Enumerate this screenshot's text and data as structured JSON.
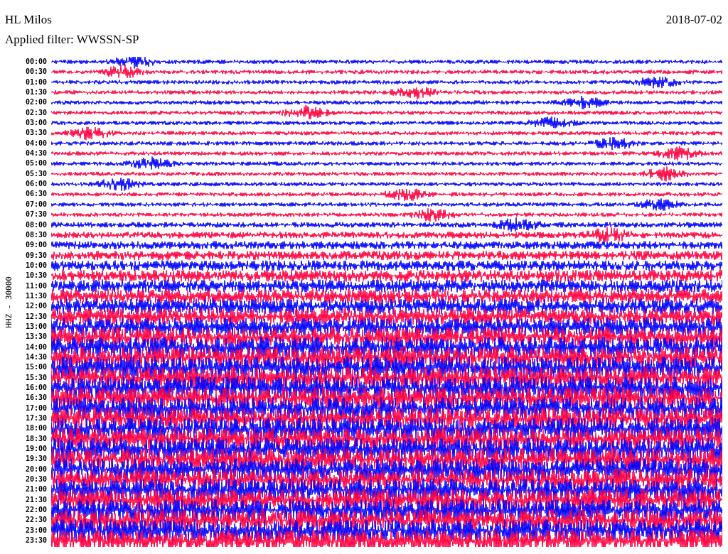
{
  "station": "HL Milos",
  "date": "2018-07-02",
  "filter": "Applied filter: WWSSN-SP",
  "channel_label": "HHZ - 30000",
  "rows": [
    {
      "time": "00:00",
      "color": "#0000ff"
    },
    {
      "time": "00:30",
      "color": "#ff0040"
    },
    {
      "time": "01:00",
      "color": "#0000ff"
    },
    {
      "time": "01:30",
      "color": "#ff0040"
    },
    {
      "time": "02:00",
      "color": "#0000ff"
    },
    {
      "time": "02:30",
      "color": "#ff0040"
    },
    {
      "time": "03:00",
      "color": "#0000ff"
    },
    {
      "time": "03:30",
      "color": "#ff0040"
    },
    {
      "time": "04:00",
      "color": "#0000ff"
    },
    {
      "time": "04:30",
      "color": "#ff0040"
    },
    {
      "time": "05:00",
      "color": "#0000ff"
    },
    {
      "time": "05:30",
      "color": "#ff0040"
    },
    {
      "time": "06:00",
      "color": "#0000ff"
    },
    {
      "time": "06:30",
      "color": "#ff0040"
    },
    {
      "time": "07:00",
      "color": "#0000ff"
    },
    {
      "time": "07:30",
      "color": "#ff0040"
    },
    {
      "time": "08:00",
      "color": "#0000ff"
    },
    {
      "time": "08:30",
      "color": "#ff0040"
    },
    {
      "time": "09:00",
      "color": "#0000ff"
    },
    {
      "time": "09:30",
      "color": "#ff0040"
    },
    {
      "time": "10:00",
      "color": "#0000ff"
    },
    {
      "time": "10:30",
      "color": "#ff0040"
    },
    {
      "time": "11:00",
      "color": "#0000ff"
    },
    {
      "time": "11:30",
      "color": "#ff0040"
    },
    {
      "time": "12:00",
      "color": "#0000ff"
    },
    {
      "time": "12:30",
      "color": "#ff0040"
    },
    {
      "time": "13:00",
      "color": "#0000ff"
    },
    {
      "time": "13:30",
      "color": "#ff0040"
    },
    {
      "time": "14:00",
      "color": "#0000ff"
    },
    {
      "time": "14:30",
      "color": "#ff0040"
    },
    {
      "time": "15:00",
      "color": "#0000ff"
    },
    {
      "time": "15:30",
      "color": "#ff0040"
    },
    {
      "time": "16:00",
      "color": "#0000ff"
    },
    {
      "time": "16:30",
      "color": "#ff0040"
    },
    {
      "time": "17:00",
      "color": "#0000ff"
    },
    {
      "time": "17:30",
      "color": "#ff0040"
    },
    {
      "time": "18:00",
      "color": "#0000ff"
    },
    {
      "time": "18:30",
      "color": "#ff0040"
    },
    {
      "time": "19:00",
      "color": "#0000ff"
    },
    {
      "time": "19:30",
      "color": "#ff0040"
    },
    {
      "time": "20:00",
      "color": "#0000ff"
    },
    {
      "time": "20:30",
      "color": "#ff0040"
    },
    {
      "time": "21:00",
      "color": "#0000ff"
    },
    {
      "time": "21:30",
      "color": "#ff0040"
    },
    {
      "time": "22:00",
      "color": "#0000ff"
    },
    {
      "time": "22:30",
      "color": "#ff0040"
    },
    {
      "time": "23:00",
      "color": "#0000ff"
    },
    {
      "time": "23:30",
      "color": "#ff0040"
    }
  ]
}
